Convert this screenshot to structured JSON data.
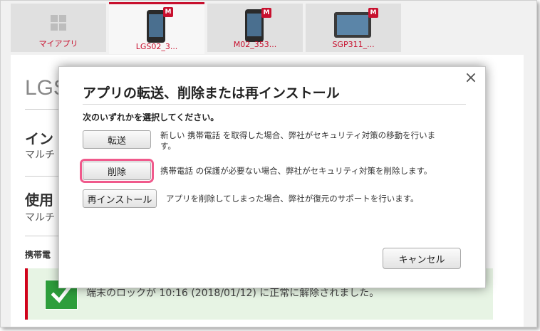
{
  "tabs": [
    {
      "label": "マイアプリ"
    },
    {
      "label": "LGS02_3..."
    },
    {
      "label": "M02_353..."
    },
    {
      "label": "SGP311_..."
    }
  ],
  "badge_letter": "M",
  "background": {
    "page_title": "LGS",
    "section1_heading": "イン",
    "section1_sub": "マルチ",
    "section2_heading": "使用",
    "section2_sub": "マルチ",
    "small_heading": "携帯電",
    "success_message": "端末のロックが 10:16 (2018/01/12) に正常に解除されました。"
  },
  "modal": {
    "title": "アプリの転送、削除または再インストール",
    "instruction": "次のいずれかを選択してください。",
    "close_glyph": "×",
    "options": [
      {
        "button": "転送",
        "desc": "新しい 携帯電話 を取得した場合、弊社がセキュリティ対策の移動を行いま",
        "desc2": "す。"
      },
      {
        "button": "削除",
        "desc": "携帯電話 の保護が必要ない場合、弊社がセキュリティ対策を削除します。"
      },
      {
        "button": "再インストール",
        "desc": "アプリを削除してしまった場合、弊社が復元のサポートを行います。"
      }
    ],
    "cancel": "キャンセル"
  },
  "colors": {
    "accent_red": "#c8102e",
    "success_green": "#2e9e3c",
    "highlight_pink": "#f05a8c"
  }
}
